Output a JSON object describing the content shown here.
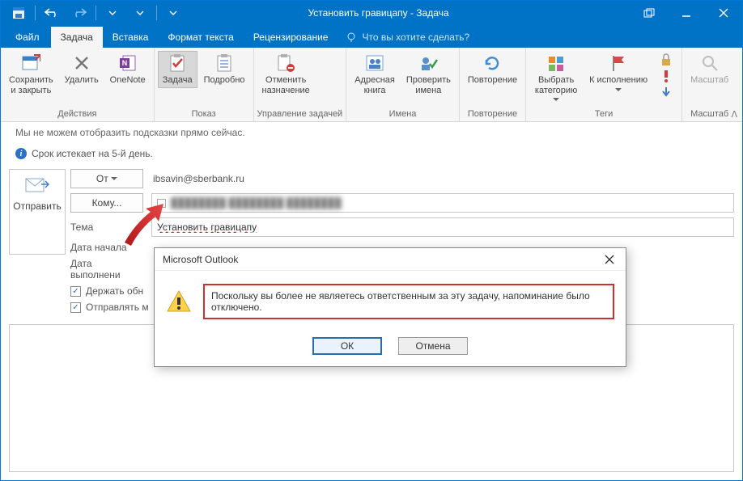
{
  "window": {
    "title": "Установить гравицапу - Задача"
  },
  "tabs": {
    "file": "Файл",
    "task": "Задача",
    "insert": "Вставка",
    "format": "Формат текста",
    "review": "Рецензирование",
    "tell_me": "Что вы хотите сделать?"
  },
  "ribbon": {
    "groups": {
      "actions": "Действия",
      "show": "Показ",
      "manage": "Управление задачей",
      "names": "Имена",
      "recurrence": "Повторение",
      "tags": "Теги",
      "zoom": "Масштаб"
    },
    "buttons": {
      "save_close": "Сохранить\nи закрыть",
      "delete": "Удалить",
      "onenote": "OneNote",
      "task": "Задача",
      "details": "Подробно",
      "cancel_assign": "Отменить\nназначение",
      "address_book": "Адресная\nкнига",
      "check_names": "Проверить\nимена",
      "recurrence": "Повторение",
      "category": "Выбрать\nкатегорию",
      "followup": "К исполнению",
      "zoom": "Масштаб"
    }
  },
  "infobar": {
    "tips": "Мы не можем отобразить подсказки прямо сейчас.",
    "due": "Срок истекает на 5-й день."
  },
  "form": {
    "send": "Отправить",
    "from_btn": "От",
    "from_value": "ibsavin@sberbank.ru",
    "to_btn": "Кому...",
    "to_value": "████████ ████████ ████████",
    "subject_label": "Тема",
    "subject_value": "Установить гравицапу",
    "start_label": "Дата начала",
    "due_label": "Дата выполнени",
    "keep_updated": "Держать обн",
    "send_me": "Отправлять м"
  },
  "dialog": {
    "title": "Microsoft Outlook",
    "message": "Поскольку вы более не являетесь ответственным за эту задачу, напоминание было отключено.",
    "ok": "ОК",
    "cancel": "Отмена"
  }
}
